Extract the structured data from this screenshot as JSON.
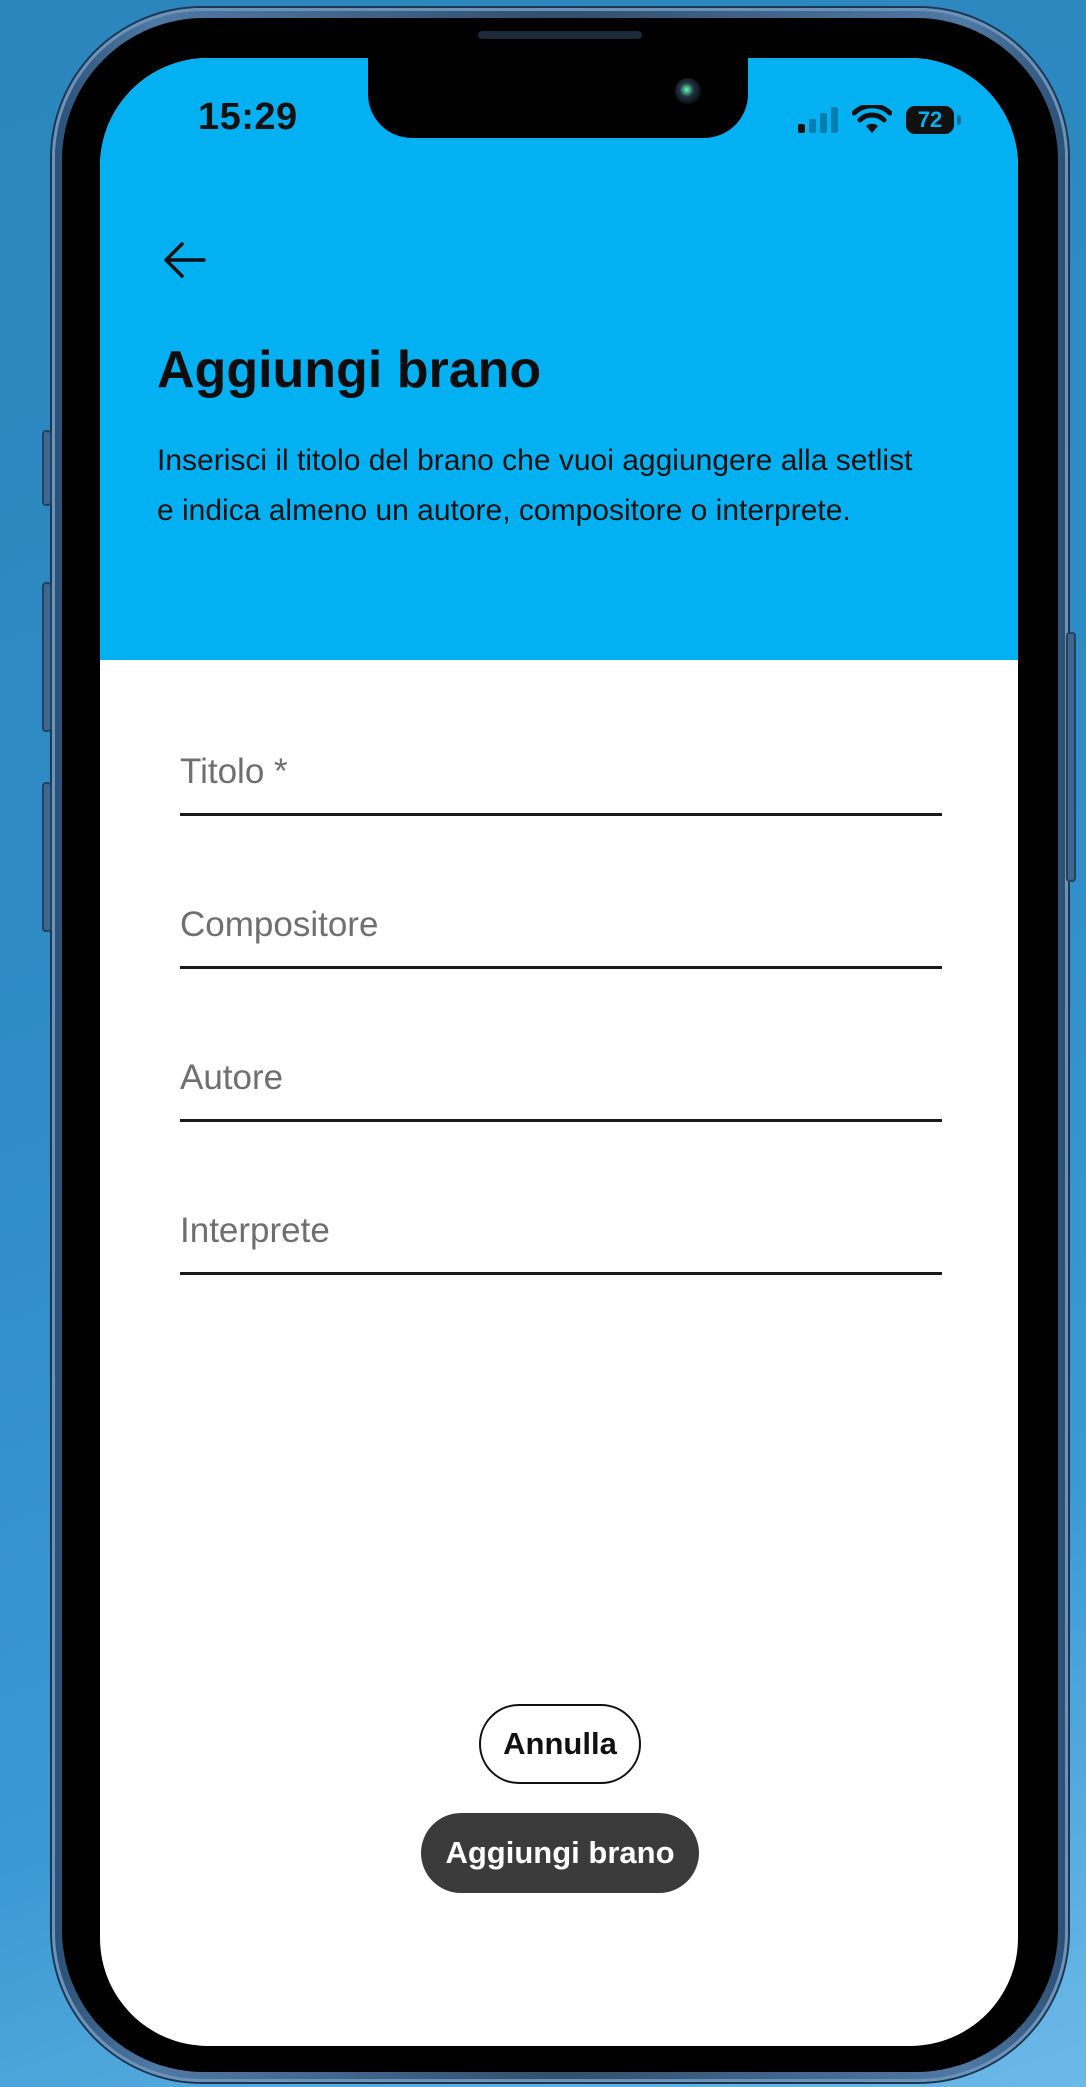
{
  "status_bar": {
    "time": "15:29",
    "battery_level": "72",
    "signal_bars_active": 1,
    "signal_bars_total": 4
  },
  "header": {
    "back_icon": "arrow-left-icon",
    "title": "Aggiungi brano",
    "subtitle": "Inserisci il titolo del brano che vuoi aggiungere alla setlist e indica almeno un autore, compositore o interprete.",
    "background_color": "#03b0f2"
  },
  "form": {
    "fields": [
      {
        "placeholder": "Titolo *",
        "value": ""
      },
      {
        "placeholder": "Compositore",
        "value": ""
      },
      {
        "placeholder": "Autore",
        "value": ""
      },
      {
        "placeholder": "Interprete",
        "value": ""
      }
    ]
  },
  "actions": {
    "cancel_label": "Annulla",
    "submit_label": "Aggiungi brano",
    "submit_color": "#3b3b3b"
  }
}
